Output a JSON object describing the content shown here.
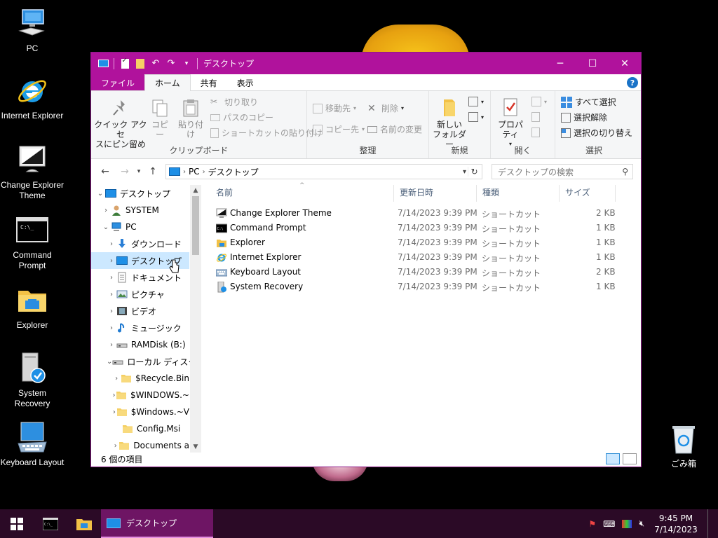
{
  "desktop_icons": [
    {
      "name": "desk-icon-pc",
      "label": "PC",
      "icon": "pc-icon"
    },
    {
      "name": "desk-icon-internet-explorer",
      "label": "Internet Explorer",
      "icon": "internet-explorer-icon"
    },
    {
      "name": "desk-icon-change-explorer-theme",
      "label": "Change Explorer Theme",
      "icon": "monitor-theme-icon"
    },
    {
      "name": "desk-icon-command-prompt",
      "label": "Command Prompt",
      "icon": "command-prompt-icon"
    },
    {
      "name": "desk-icon-explorer",
      "label": "Explorer",
      "icon": "explorer-folder-icon"
    },
    {
      "name": "desk-icon-system-recovery",
      "label": "System Recovery",
      "icon": "system-recovery-icon"
    },
    {
      "name": "desk-icon-keyboard-layout",
      "label": "Keyboard Layout",
      "icon": "keyboard-icon"
    }
  ],
  "recycle_bin": {
    "label": "ごみ箱",
    "icon": "recycle-bin-icon"
  },
  "window": {
    "title": "デスクトップ",
    "accent": "#b0129c",
    "tabs": {
      "file": "ファイル",
      "home": "ホーム",
      "share": "共有",
      "view": "表示"
    },
    "help": "?"
  },
  "ribbon": {
    "clipboard": {
      "pin": "クイック アクセスにピン留め",
      "pin_line1": "クイック アクセ",
      "pin_line2": "スにピン留め",
      "copy": "コピー",
      "paste": "貼り付け",
      "cut": "切り取り",
      "copy_path": "パスのコピー",
      "paste_shortcut": "ショートカットの貼り付け",
      "label": "クリップボード"
    },
    "organize": {
      "move_to": "移動先",
      "copy_to": "コピー先",
      "delete": "削除",
      "rename": "名前の変更",
      "label": "整理"
    },
    "new": {
      "new_folder_line1": "新しい",
      "new_folder_line2": "フォルダー",
      "label": "新規"
    },
    "open": {
      "properties": "プロパティ",
      "label": "開く"
    },
    "select": {
      "select_all": "すべて選択",
      "select_none": "選択解除",
      "invert": "選択の切り替え",
      "label": "選択"
    }
  },
  "address": {
    "segments": [
      "PC",
      "デスクトップ"
    ],
    "search_placeholder": "デスクトップの検索"
  },
  "nav_tree": [
    {
      "label": "デスクトップ",
      "indent": 0,
      "arrow": "v",
      "icon": "desktop-icon"
    },
    {
      "label": "SYSTEM",
      "indent": 1,
      "arrow": ">",
      "icon": "user-icon"
    },
    {
      "label": "PC",
      "indent": 1,
      "arrow": "v",
      "icon": "pc-icon"
    },
    {
      "label": "ダウンロード",
      "indent": 2,
      "arrow": ">",
      "icon": "downloads-icon"
    },
    {
      "label": "デスクトップ",
      "indent": 2,
      "arrow": ">",
      "icon": "desktop-icon",
      "selected": true
    },
    {
      "label": "ドキュメント",
      "indent": 2,
      "arrow": ">",
      "icon": "documents-icon"
    },
    {
      "label": "ピクチャ",
      "indent": 2,
      "arrow": ">",
      "icon": "pictures-icon"
    },
    {
      "label": "ビデオ",
      "indent": 2,
      "arrow": ">",
      "icon": "videos-icon"
    },
    {
      "label": "ミュージック",
      "indent": 2,
      "arrow": ">",
      "icon": "music-icon"
    },
    {
      "label": "RAMDisk (B:)",
      "indent": 2,
      "arrow": ">",
      "icon": "drive-icon"
    },
    {
      "label": "ローカル ディスク (",
      "indent": 2,
      "arrow": "v",
      "icon": "drive-icon"
    },
    {
      "label": "$Recycle.Bin",
      "indent": 3,
      "arrow": ">",
      "icon": "folder-icon"
    },
    {
      "label": "$WINDOWS.~",
      "indent": 3,
      "arrow": ">",
      "icon": "folder-icon"
    },
    {
      "label": "$Windows.~V",
      "indent": 3,
      "arrow": ">",
      "icon": "folder-icon"
    },
    {
      "label": "Config.Msi",
      "indent": 3,
      "arrow": "",
      "icon": "folder-icon"
    },
    {
      "label": "Documents a",
      "indent": 3,
      "arrow": ">",
      "icon": "folder-icon"
    }
  ],
  "columns": {
    "name": "名前",
    "date": "更新日時",
    "type": "種類",
    "size": "サイズ"
  },
  "files": [
    {
      "name": "Change Explorer Theme",
      "date": "7/14/2023 9:39 PM",
      "type": "ショートカット",
      "size": "2 KB",
      "icon": "monitor-theme-icon"
    },
    {
      "name": "Command Prompt",
      "date": "7/14/2023 9:39 PM",
      "type": "ショートカット",
      "size": "1 KB",
      "icon": "command-prompt-icon"
    },
    {
      "name": "Explorer",
      "date": "7/14/2023 9:39 PM",
      "type": "ショートカット",
      "size": "1 KB",
      "icon": "explorer-folder-icon"
    },
    {
      "name": "Internet Explorer",
      "date": "7/14/2023 9:39 PM",
      "type": "ショートカット",
      "size": "1 KB",
      "icon": "internet-explorer-icon"
    },
    {
      "name": "Keyboard Layout",
      "date": "7/14/2023 9:39 PM",
      "type": "ショートカット",
      "size": "2 KB",
      "icon": "keyboard-icon"
    },
    {
      "name": "System Recovery",
      "date": "7/14/2023 9:39 PM",
      "type": "ショートカット",
      "size": "1 KB",
      "icon": "system-recovery-icon"
    }
  ],
  "status": {
    "count": "6 個の項目"
  },
  "taskbar": {
    "active_label": "デスクトップ",
    "time": "9:45 PM",
    "date": "7/14/2023"
  }
}
